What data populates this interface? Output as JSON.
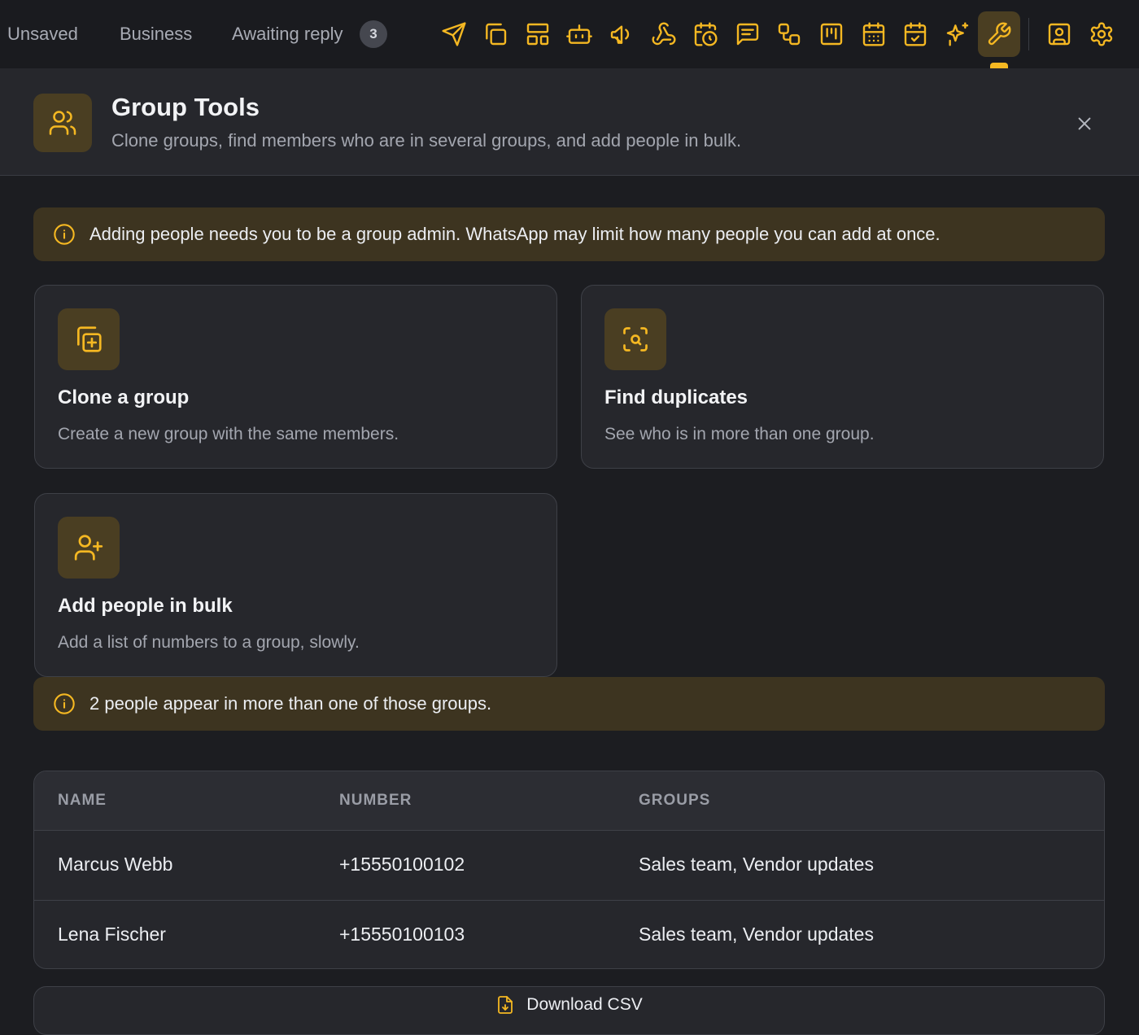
{
  "tabs": [
    {
      "label": "Unsaved"
    },
    {
      "label": "Business"
    },
    {
      "label": "Awaiting reply",
      "badge": "3"
    }
  ],
  "toolbar": {
    "icons": [
      "send-icon",
      "copy-icon",
      "layout-icon",
      "bot-icon",
      "megaphone-icon",
      "webhook-icon",
      "calendar-clock-icon",
      "message-square-icon",
      "workflow-icon",
      "kanban-icon",
      "calendar-grid-icon",
      "calendar-check-icon",
      "sparkles-icon",
      "wrench-icon",
      "contact-icon",
      "gear-icon"
    ],
    "active": "wrench-icon",
    "accent_color": "#f5b822"
  },
  "header": {
    "title": "Group Tools",
    "subtitle": "Clone groups, find members who are in several groups, and add people in bulk."
  },
  "notice_admin": "Adding people needs you to be a group admin. WhatsApp may limit how many people you can add at once.",
  "cards": [
    {
      "title": "Clone a group",
      "description": "Create a new group with the same members."
    },
    {
      "title": "Find duplicates",
      "description": "See who is in more than one group."
    },
    {
      "title": "Add people in bulk",
      "description": "Add a list of numbers to a group, slowly."
    }
  ],
  "notice_result": "2 people appear in more than one of those groups.",
  "table": {
    "headers": [
      "NAME",
      "NUMBER",
      "GROUPS"
    ],
    "rows": [
      {
        "name": "Marcus Webb",
        "number": "+15550100102",
        "groups": "Sales team, Vendor updates"
      },
      {
        "name": "Lena Fischer",
        "number": "+15550100103",
        "groups": "Sales team, Vendor updates"
      }
    ]
  },
  "download_label": "Download CSV"
}
